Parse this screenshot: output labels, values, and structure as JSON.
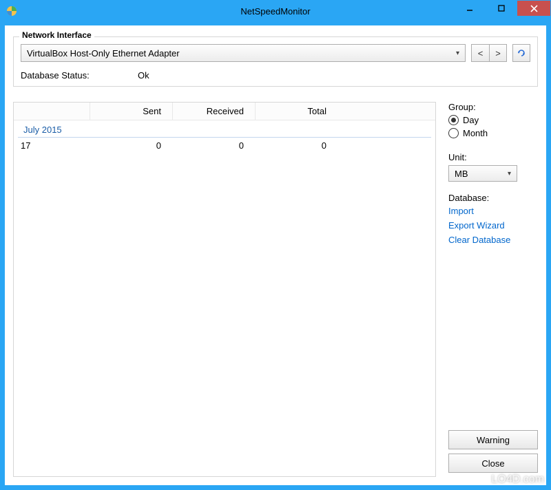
{
  "window": {
    "title": "NetSpeedMonitor"
  },
  "fieldset": {
    "legend": "Network Interface",
    "interface_selected": "VirtualBox Host-Only Ethernet Adapter",
    "db_status_label": "Database Status:",
    "db_status_value": "Ok"
  },
  "table": {
    "headers": {
      "sent": "Sent",
      "received": "Received",
      "total": "Total"
    },
    "group_label": "July 2015",
    "rows": [
      {
        "day": "17",
        "sent": "0",
        "received": "0",
        "total": "0"
      }
    ]
  },
  "side": {
    "group_label": "Group:",
    "radio_day": "Day",
    "radio_month": "Month",
    "group_selected": "Day",
    "unit_label": "Unit:",
    "unit_selected": "MB",
    "database_label": "Database:",
    "link_import": "Import",
    "link_export": "Export Wizard",
    "link_clear": "Clear Database",
    "btn_warning": "Warning",
    "btn_close": "Close"
  },
  "watermark": "LO4D.com"
}
